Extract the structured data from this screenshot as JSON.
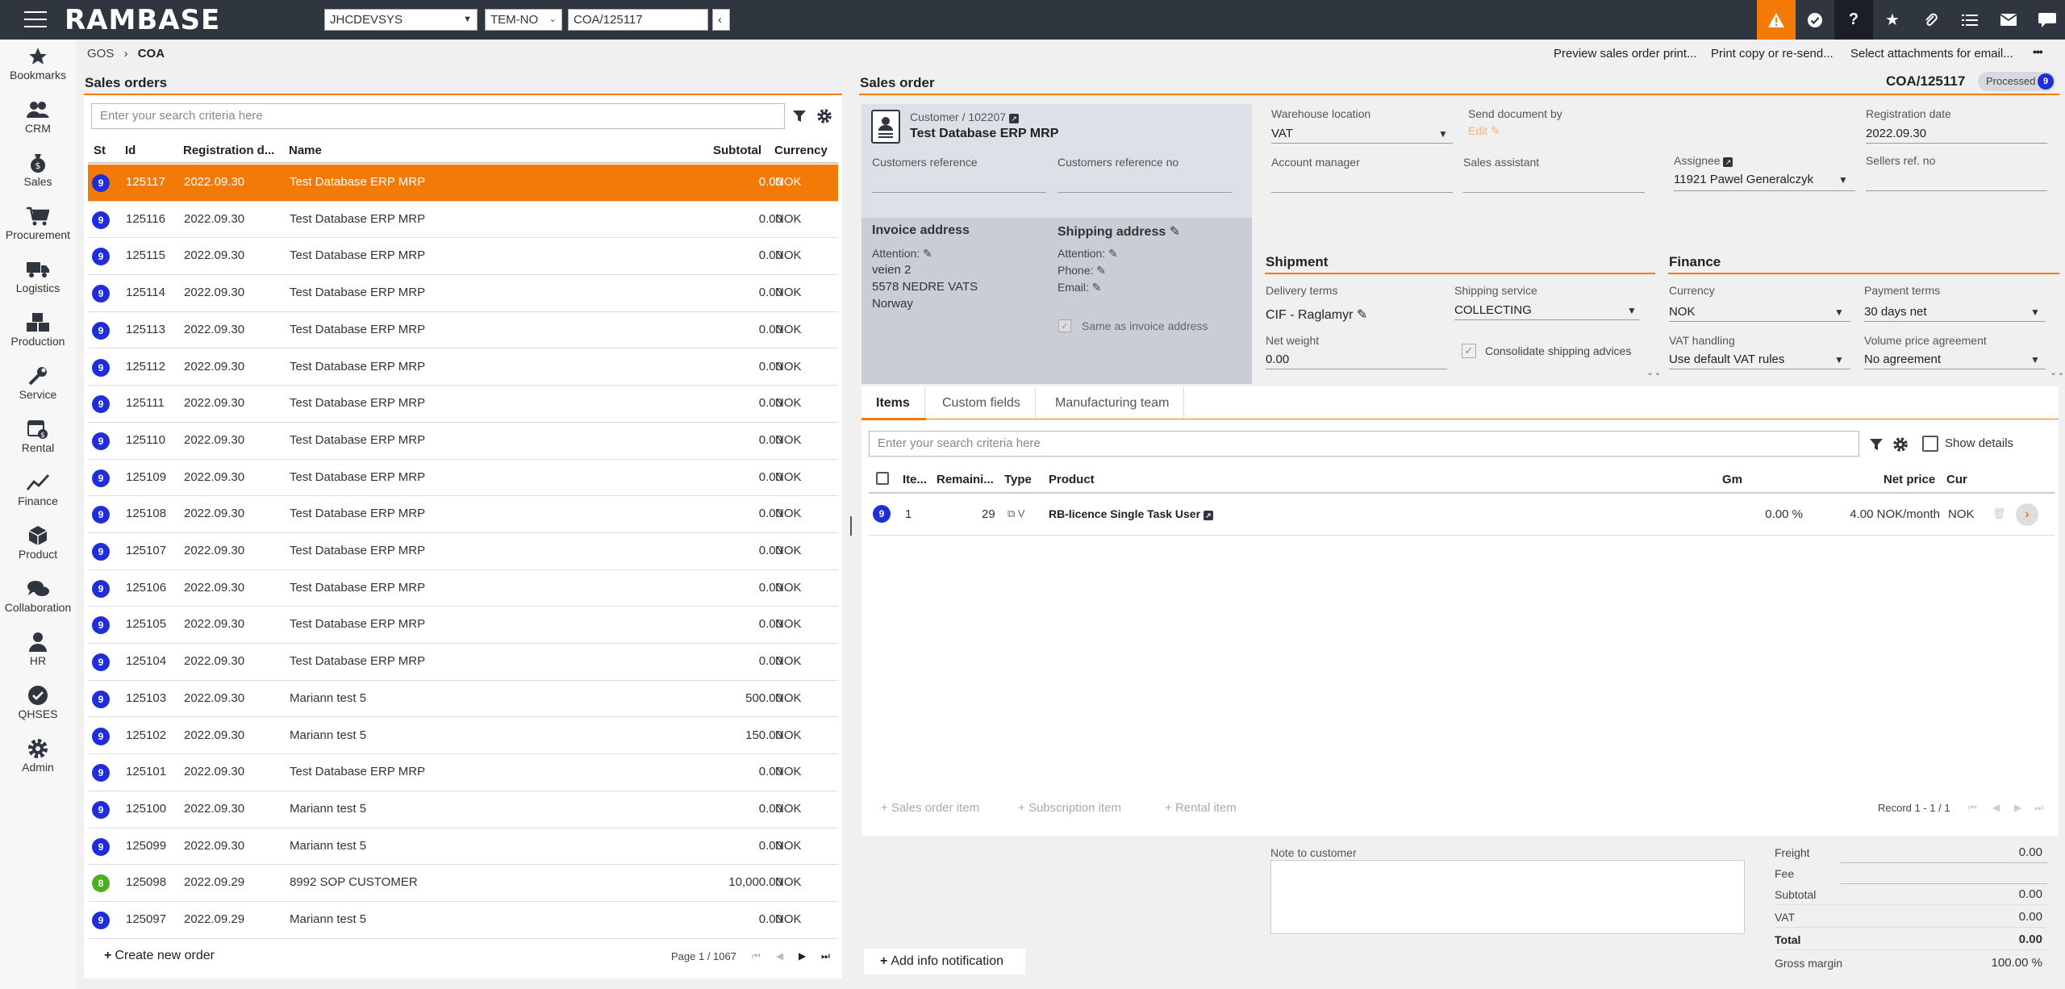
{
  "topbar": {
    "logo": "RAMBASE",
    "company": "JHCDEVSYS",
    "template": "TEM-NO",
    "document": "COA/125117",
    "back": "‹"
  },
  "nav": [
    {
      "label": "Bookmarks",
      "icon": "star-icon"
    },
    {
      "label": "CRM",
      "icon": "people-icon"
    },
    {
      "label": "Sales",
      "icon": "money-bag-icon"
    },
    {
      "label": "Procurement",
      "icon": "cart-icon"
    },
    {
      "label": "Logistics",
      "icon": "truck-icon"
    },
    {
      "label": "Production",
      "icon": "boxes-icon"
    },
    {
      "label": "Service",
      "icon": "wrench-icon"
    },
    {
      "label": "Rental",
      "icon": "calendar-money-icon"
    },
    {
      "label": "Finance",
      "icon": "chart-line-icon"
    },
    {
      "label": "Product",
      "icon": "cube-icon"
    },
    {
      "label": "Collaboration",
      "icon": "chat-icon"
    },
    {
      "label": "HR",
      "icon": "person-icon"
    },
    {
      "label": "QHSES",
      "icon": "check-badge-icon"
    },
    {
      "label": "Admin",
      "icon": "gear-icon"
    }
  ],
  "breadcrumb": {
    "root": "GOS",
    "sep": "›",
    "current": "COA"
  },
  "actions": {
    "preview": "Preview sales order print...",
    "print": "Print copy or re-send...",
    "attachments": "Select attachments for email...",
    "more": "•••"
  },
  "list": {
    "title": "Sales orders",
    "search_placeholder": "Enter your search criteria here",
    "columns": {
      "st": "St",
      "id": "Id",
      "date": "Registration d...",
      "name": "Name",
      "subtotal": "Subtotal",
      "currency": "Currency"
    },
    "rows": [
      {
        "st": "9",
        "id": "125117",
        "date": "2022.09.30",
        "name": "Test Database ERP MRP",
        "subtotal": "0.00",
        "currency": "NOK"
      },
      {
        "st": "9",
        "id": "125116",
        "date": "2022.09.30",
        "name": "Test Database ERP MRP",
        "subtotal": "0.00",
        "currency": "NOK"
      },
      {
        "st": "9",
        "id": "125115",
        "date": "2022.09.30",
        "name": "Test Database ERP MRP",
        "subtotal": "0.00",
        "currency": "NOK"
      },
      {
        "st": "9",
        "id": "125114",
        "date": "2022.09.30",
        "name": "Test Database ERP MRP",
        "subtotal": "0.00",
        "currency": "NOK"
      },
      {
        "st": "9",
        "id": "125113",
        "date": "2022.09.30",
        "name": "Test Database ERP MRP",
        "subtotal": "0.00",
        "currency": "NOK"
      },
      {
        "st": "9",
        "id": "125112",
        "date": "2022.09.30",
        "name": "Test Database ERP MRP",
        "subtotal": "0.00",
        "currency": "NOK"
      },
      {
        "st": "9",
        "id": "125111",
        "date": "2022.09.30",
        "name": "Test Database ERP MRP",
        "subtotal": "0.00",
        "currency": "NOK"
      },
      {
        "st": "9",
        "id": "125110",
        "date": "2022.09.30",
        "name": "Test Database ERP MRP",
        "subtotal": "0.00",
        "currency": "NOK"
      },
      {
        "st": "9",
        "id": "125109",
        "date": "2022.09.30",
        "name": "Test Database ERP MRP",
        "subtotal": "0.00",
        "currency": "NOK"
      },
      {
        "st": "9",
        "id": "125108",
        "date": "2022.09.30",
        "name": "Test Database ERP MRP",
        "subtotal": "0.00",
        "currency": "NOK"
      },
      {
        "st": "9",
        "id": "125107",
        "date": "2022.09.30",
        "name": "Test Database ERP MRP",
        "subtotal": "0.00",
        "currency": "NOK"
      },
      {
        "st": "9",
        "id": "125106",
        "date": "2022.09.30",
        "name": "Test Database ERP MRP",
        "subtotal": "0.00",
        "currency": "NOK"
      },
      {
        "st": "9",
        "id": "125105",
        "date": "2022.09.30",
        "name": "Test Database ERP MRP",
        "subtotal": "0.00",
        "currency": "NOK"
      },
      {
        "st": "9",
        "id": "125104",
        "date": "2022.09.30",
        "name": "Test Database ERP MRP",
        "subtotal": "0.00",
        "currency": "NOK"
      },
      {
        "st": "9",
        "id": "125103",
        "date": "2022.09.30",
        "name": "Mariann test 5",
        "subtotal": "500.00",
        "currency": "NOK"
      },
      {
        "st": "9",
        "id": "125102",
        "date": "2022.09.30",
        "name": "Mariann test 5",
        "subtotal": "150.00",
        "currency": "NOK"
      },
      {
        "st": "9",
        "id": "125101",
        "date": "2022.09.30",
        "name": "Test Database ERP MRP",
        "subtotal": "0.00",
        "currency": "NOK"
      },
      {
        "st": "9",
        "id": "125100",
        "date": "2022.09.30",
        "name": "Mariann test 5",
        "subtotal": "0.00",
        "currency": "NOK"
      },
      {
        "st": "9",
        "id": "125099",
        "date": "2022.09.30",
        "name": "Mariann test 5",
        "subtotal": "0.00",
        "currency": "NOK"
      },
      {
        "st": "8",
        "id": "125098",
        "date": "2022.09.29",
        "name": "8992 SOP CUSTOMER",
        "subtotal": "10,000.00",
        "currency": "NOK"
      },
      {
        "st": "9",
        "id": "125097",
        "date": "2022.09.29",
        "name": "Mariann test 5",
        "subtotal": "0.00",
        "currency": "NOK"
      }
    ],
    "create_label": "Create new order",
    "page_info": "Page 1 / 1067"
  },
  "order": {
    "title": "Sales order",
    "doc_id": "COA/125117",
    "status_label": "Processed",
    "status_num": "9",
    "customer": {
      "label": "Customer / 102207",
      "name": "Test Database ERP MRP"
    },
    "customers_reference_label": "Customers reference",
    "customers_reference_no_label": "Customers reference no",
    "invoice": {
      "title": "Invoice address",
      "attention": "Attention:",
      "line1": "veien 2",
      "line2": "5578 NEDRE VATS",
      "line3": "Norway"
    },
    "shipping": {
      "title": "Shipping address",
      "attention": "Attention:",
      "phone": "Phone:",
      "email": "Email:",
      "same_as": "Same as invoice address"
    },
    "warehouse": {
      "label": "Warehouse location",
      "value": "VAT"
    },
    "send_by": {
      "label": "Send document by",
      "value": "Edit"
    },
    "registration": {
      "label": "Registration date",
      "value": "2022.09.30"
    },
    "account_manager_label": "Account manager",
    "sales_assistant_label": "Sales assistant",
    "assignee": {
      "label": "Assignee",
      "value": "11921 Pawel Generalczyk"
    },
    "sellers_ref_label": "Sellers ref. no",
    "shipment": {
      "title": "Shipment",
      "delivery_terms_label": "Delivery terms",
      "delivery_terms": "CIF - Raglamyr",
      "shipping_service_label": "Shipping service",
      "shipping_service": "COLLECTING",
      "net_weight_label": "Net weight",
      "net_weight": "0.00",
      "consolidate": "Consolidate shipping advices"
    },
    "finance": {
      "title": "Finance",
      "currency_label": "Currency",
      "currency": "NOK",
      "payment_terms_label": "Payment terms",
      "payment_terms": "30 days net",
      "vat_label": "VAT handling",
      "vat": "Use default VAT rules",
      "volume_label": "Volume price agreement",
      "volume": "No agreement"
    },
    "tabs": [
      "Items",
      "Custom fields",
      "Manufacturing team"
    ],
    "items_search_placeholder": "Enter your search criteria here",
    "show_details": "Show details",
    "item_columns": {
      "item": "Ite...",
      "remaining": "Remaini...",
      "type": "Type",
      "product": "Product",
      "gm": "Gm",
      "net_price": "Net price",
      "cur": "Cur"
    },
    "items": [
      {
        "st": "9",
        "item": "1",
        "remaining": "29",
        "type": "V",
        "product": "RB-licence Single Task User",
        "gm": "0.00 %",
        "net_price": "4.00 NOK/month",
        "cur": "NOK"
      }
    ],
    "add_buttons": {
      "sales": "Sales order item",
      "subscription": "Subscription item",
      "rental": "Rental item"
    },
    "record": "Record 1 - 1 / 1",
    "note_label": "Note to customer",
    "add_info": "Add info notification",
    "totals": {
      "freight_label": "Freight",
      "freight": "0.00",
      "fee_label": "Fee",
      "fee": "",
      "subtotal_label": "Subtotal",
      "subtotal": "0.00",
      "vat_label": "VAT",
      "vat": "0.00",
      "total_label": "Total",
      "total": "0.00",
      "margin_label": "Gross margin",
      "margin": "100.00 %"
    }
  },
  "colors": {
    "accent": "#f47a08",
    "status_blue": "#1f2ed8",
    "status_green": "#4caf22",
    "topbar": "#2f3640"
  }
}
